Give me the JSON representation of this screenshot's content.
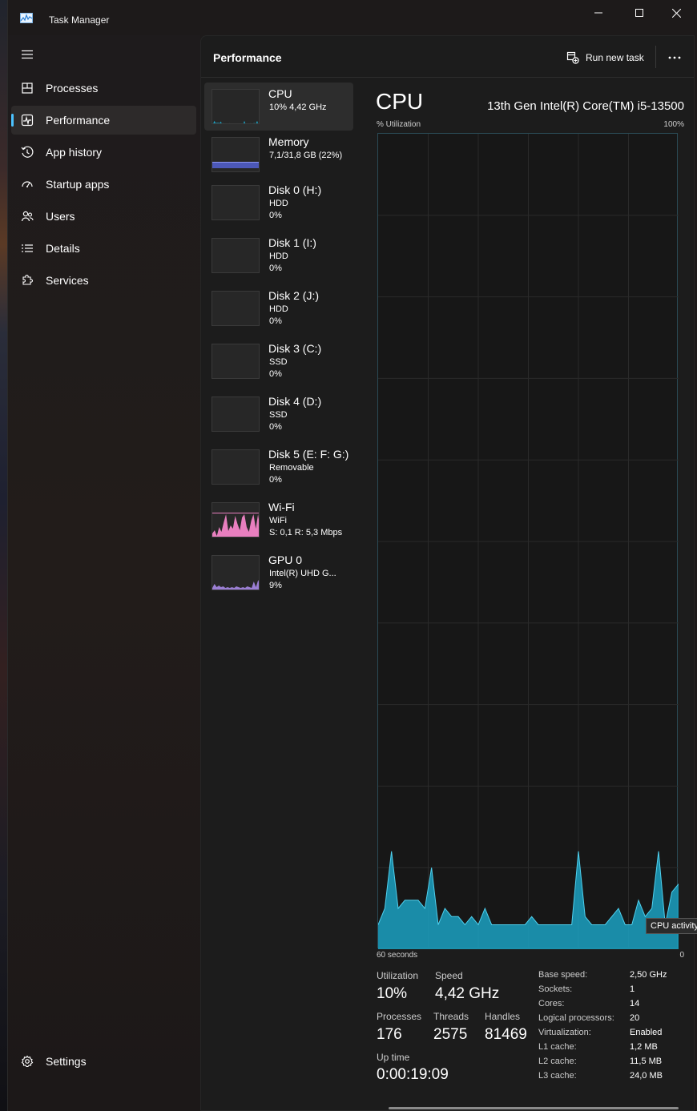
{
  "window": {
    "title": "Task Manager"
  },
  "nav": {
    "items": [
      {
        "label": "Processes"
      },
      {
        "label": "Performance"
      },
      {
        "label": "App history"
      },
      {
        "label": "Startup apps"
      },
      {
        "label": "Users"
      },
      {
        "label": "Details"
      },
      {
        "label": "Services"
      }
    ],
    "settings": "Settings",
    "active_index": 1
  },
  "header": {
    "title": "Performance",
    "run_new_task": "Run new task"
  },
  "devices": [
    {
      "name": "CPU",
      "sub": "10% 4,42 GHz",
      "sub2": ""
    },
    {
      "name": "Memory",
      "sub": "7,1/31,8 GB (22%)",
      "sub2": ""
    },
    {
      "name": "Disk 0 (H:)",
      "sub": "HDD",
      "sub2": "0%"
    },
    {
      "name": "Disk 1 (I:)",
      "sub": "HDD",
      "sub2": "0%"
    },
    {
      "name": "Disk 2 (J:)",
      "sub": "HDD",
      "sub2": "0%"
    },
    {
      "name": "Disk 3 (C:)",
      "sub": "SSD",
      "sub2": "0%"
    },
    {
      "name": "Disk 4 (D:)",
      "sub": "SSD",
      "sub2": "0%"
    },
    {
      "name": "Disk 5 (E: F: G:)",
      "sub": "Removable",
      "sub2": "0%"
    },
    {
      "name": "Wi-Fi",
      "sub": "WiFi",
      "sub2": "S: 0,1 R: 5,3 Mbps"
    },
    {
      "name": "GPU 0",
      "sub": "Intel(R) UHD G...",
      "sub2": "9%"
    }
  ],
  "detail": {
    "title": "CPU",
    "model": "13th Gen Intel(R) Core(TM) i5-13500",
    "y_label": "% Utilization",
    "y_max_label": "100%",
    "x_left_label": "60 seconds",
    "x_right_label": "0",
    "tooltip": "CPU activity",
    "stats": {
      "utilization_label": "Utilization",
      "utilization": "10%",
      "speed_label": "Speed",
      "speed": "4,42 GHz",
      "processes_label": "Processes",
      "processes": "176",
      "threads_label": "Threads",
      "threads": "2575",
      "handles_label": "Handles",
      "handles": "81469",
      "uptime_label": "Up time",
      "uptime": "0:00:19:09"
    },
    "specs": [
      {
        "key": "Base speed:",
        "value": "2,50 GHz"
      },
      {
        "key": "Sockets:",
        "value": "1"
      },
      {
        "key": "Cores:",
        "value": "14"
      },
      {
        "key": "Logical processors:",
        "value": "20"
      },
      {
        "key": "Virtualization:",
        "value": "Enabled"
      },
      {
        "key": "L1 cache:",
        "value": "1,2 MB"
      },
      {
        "key": "L2 cache:",
        "value": "11,5 MB"
      },
      {
        "key": "L3 cache:",
        "value": "24,0 MB"
      }
    ]
  },
  "cpu_history_percent": [
    3,
    5,
    12,
    5,
    6,
    6,
    6,
    5,
    10,
    3,
    5,
    4,
    4,
    3,
    4,
    3,
    5,
    3,
    3,
    3,
    3,
    3,
    3,
    4,
    3,
    3,
    3,
    3,
    3,
    3,
    12,
    4,
    3,
    3,
    3,
    4,
    5,
    3,
    3,
    6,
    4,
    5,
    12,
    3,
    7,
    8
  ],
  "colors": {
    "cpu": "#1ba1c2",
    "memory": "#6c7ae0",
    "wifi": "#e87fbf",
    "gpu": "#9b7fd4",
    "disk": "#2aa889",
    "accent": "#4cc2ff"
  }
}
